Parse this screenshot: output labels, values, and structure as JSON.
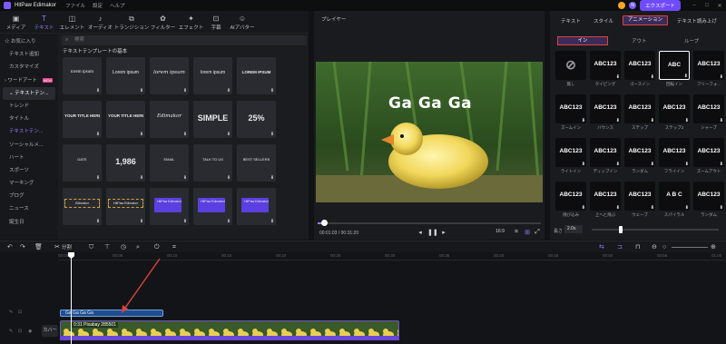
{
  "app": {
    "title": "HitPaw Edimakor",
    "menu": [
      "ファイル",
      "設定",
      "ヘルプ"
    ],
    "export_label": "エクスポート",
    "user_initial": "N"
  },
  "toolbar": {
    "items": [
      {
        "label": "メディア",
        "icon": "film-icon"
      },
      {
        "label": "テキスト",
        "icon": "text-icon",
        "active": true
      },
      {
        "label": "エレメント",
        "icon": "shapes-icon"
      },
      {
        "label": "オーディオ",
        "icon": "music-icon"
      },
      {
        "label": "トランジション",
        "icon": "transition-icon"
      },
      {
        "label": "フィルター",
        "icon": "filter-icon"
      },
      {
        "label": "エフェクト",
        "icon": "sparkle-icon"
      },
      {
        "label": "字幕",
        "icon": "subtitle-icon"
      },
      {
        "label": "AIアバター",
        "icon": "avatar-icon"
      }
    ]
  },
  "leftnav": {
    "items": [
      {
        "label": "お気に入り",
        "kind": "top"
      },
      {
        "label": "テキスト追加",
        "kind": "sub"
      },
      {
        "label": "カスタマイズ",
        "kind": "sub"
      },
      {
        "label": "ワードアート",
        "kind": "top",
        "badge": "NEW"
      },
      {
        "label": "テキストテン...",
        "kind": "top-sel"
      },
      {
        "label": "トレンド",
        "kind": "sub"
      },
      {
        "label": "タイトル",
        "kind": "sub"
      },
      {
        "label": "テキストテン...",
        "kind": "sub-sel"
      },
      {
        "label": "ソーシャルメ...",
        "kind": "sub"
      },
      {
        "label": "ハート",
        "kind": "sub"
      },
      {
        "label": "スポーツ",
        "kind": "sub"
      },
      {
        "label": "マーキング",
        "kind": "sub"
      },
      {
        "label": "ブログ",
        "kind": "sub"
      },
      {
        "label": "ニュース",
        "kind": "sub"
      },
      {
        "label": "誕生日",
        "kind": "sub"
      }
    ]
  },
  "library": {
    "search_placeholder": "検索",
    "section_title": "テキストテンプレートの基本",
    "tiles": [
      {
        "text": "lorem ipsum",
        "style": "serif"
      },
      {
        "text": "Lorem ipsum",
        "style": "sans"
      },
      {
        "text": "lorem ipsum",
        "style": "script"
      },
      {
        "text": "lorem ipsum",
        "style": "thin"
      },
      {
        "text": "LOREM IPSUM",
        "style": "block"
      },
      {
        "text": "YOUR TITLE HERE",
        "style": "caps"
      },
      {
        "text": "YOUR TITLE HERE",
        "style": "caps"
      },
      {
        "text": "Edimakor",
        "style": "script-box"
      },
      {
        "text": "SIMPLE",
        "style": "big"
      },
      {
        "text": "25%",
        "style": "big"
      },
      {
        "text": "DATE",
        "style": "list"
      },
      {
        "text": "1,986",
        "style": "big"
      },
      {
        "text": "EMAIL",
        "style": "list"
      },
      {
        "text": "TALK TO US",
        "style": "list"
      },
      {
        "text": "BEST SELLERS",
        "style": "list"
      },
      {
        "text": "Edimakor",
        "style": "dotted"
      },
      {
        "text": "HitPaw Edimakor",
        "style": "banner"
      },
      {
        "text": "HitPaw Edimakor",
        "style": "purple"
      },
      {
        "text": "HitPaw Edimakor",
        "style": "purple2"
      },
      {
        "text": "HitPaw Edimakor",
        "style": "purple3"
      }
    ]
  },
  "player": {
    "label": "プレイヤー",
    "caption": "Ga Ga Ga",
    "time": "00:01:03 / 00:31:20",
    "ratio": "16:9",
    "progress": 0.033
  },
  "rightpanel": {
    "tabs": [
      "テキスト",
      "スタイル",
      "アニメーション",
      "テキスト読み上げ"
    ],
    "active_tab": "アニメーション",
    "segments": [
      "イン",
      "アウト",
      "ループ"
    ],
    "active_segment": "イン",
    "animations": [
      {
        "text": "⊘",
        "label": "無し"
      },
      {
        "text": "ABC123",
        "label": "タイピング"
      },
      {
        "text": "ABC123",
        "label": "ゴースイン"
      },
      {
        "text": "ABC",
        "label": "回転イン"
      },
      {
        "text": "ABC123",
        "label": "フリーフォ..."
      },
      {
        "text": "ABC123",
        "label": "ズームイン"
      },
      {
        "text": "ABC123",
        "label": "バウンス"
      },
      {
        "text": "ABC123",
        "label": "ステップ"
      },
      {
        "text": "ABC123",
        "label": "ステップ2"
      },
      {
        "text": "ABC123",
        "label": "シャープ"
      },
      {
        "text": "ABC123",
        "label": "ライトイン"
      },
      {
        "text": "ABC123",
        "label": "ディップイン"
      },
      {
        "text": "ABC123",
        "label": "ランダム"
      },
      {
        "text": "ABC123",
        "label": "フライイン"
      },
      {
        "text": "ABC123",
        "label": "ズームアウト"
      },
      {
        "text": "ABC123",
        "label": "飛び込み"
      },
      {
        "text": "ABC123",
        "label": "上へと飛ぶ"
      },
      {
        "text": "ABC123",
        "label": "ウェーブ"
      },
      {
        "text": "A B C",
        "label": "スパイラル"
      },
      {
        "text": "ABC123",
        "label": "ランダム"
      }
    ],
    "duration_label": "長さ",
    "duration_value": "2.0s"
  },
  "timeline_toolbar": {
    "split_label": "分割"
  },
  "timeline": {
    "ruler": [
      "00:00",
      "00:05",
      "00:10",
      "00:15",
      "00:20",
      "00:25",
      "00:30",
      "00:35",
      "00:40",
      "00:45",
      "00:50",
      "00:55",
      "01:00"
    ],
    "text_clip": "Ga Ga Ga Ga",
    "video_clip": "0:31 Pixabay 285501",
    "cover_label": "カバー"
  }
}
